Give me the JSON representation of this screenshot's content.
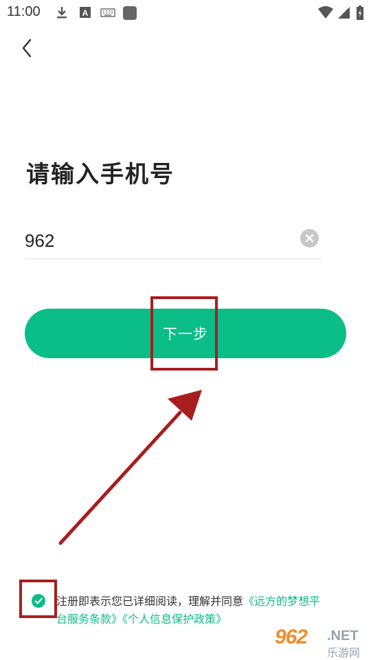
{
  "status_bar": {
    "time": "11:00",
    "icons": [
      "download-icon",
      "font-a-icon",
      "keyboard-icon",
      "app-square-icon",
      "wifi-icon",
      "cell-signal-icon",
      "battery-charging-icon"
    ]
  },
  "header": {
    "back_icon": "chevron-left-icon"
  },
  "title": "请输入手机号",
  "phone": {
    "value": "962",
    "clear_icon": "clear-x-icon"
  },
  "next_button": {
    "label": "下一步"
  },
  "agreement": {
    "checked": true,
    "prefix": "注册即表示您已详细阅读，理解并同意",
    "link_service": "《远方的梦想平台服务条款》",
    "link_privacy": "《个人信息保护政策》"
  },
  "watermark": {
    "main": "962",
    "net": ".NET",
    "sub": "乐游网"
  },
  "colors": {
    "accent": "#0bbd87",
    "annotation": "#a81e1e",
    "watermark": "#f28c28"
  }
}
